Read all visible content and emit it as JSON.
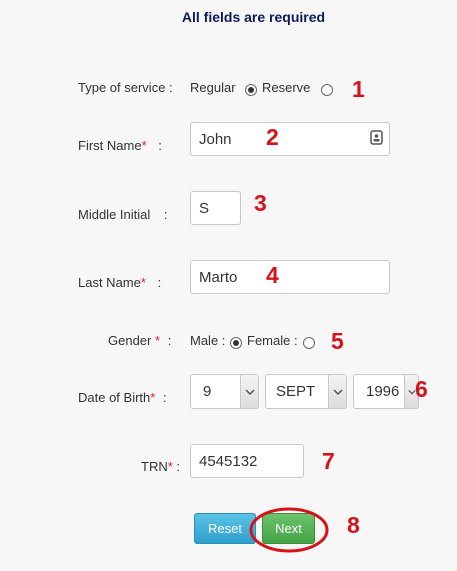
{
  "header": {
    "title": "All fields are required"
  },
  "service": {
    "label": "Type of service :",
    "option1": "Regular",
    "option2": "Reserve",
    "selected": "Regular"
  },
  "first_name": {
    "label": "First Name",
    "required": "*",
    "colon": ":",
    "value": "John"
  },
  "middle_initial": {
    "label": "Middle Initial",
    "colon": ":",
    "value": "S"
  },
  "last_name": {
    "label": "Last Name",
    "required": "*",
    "colon": ":",
    "value": "Marto"
  },
  "gender": {
    "label": "Gender",
    "required": "*",
    "colon": ":",
    "option1": "Male :",
    "option2": "Female :",
    "selected": "Male"
  },
  "dob": {
    "label": "Date of Birth",
    "required": "*",
    "colon": ":",
    "day": "9",
    "month": "SEPT",
    "year": "1996"
  },
  "trn": {
    "label": "TRN",
    "required": "*",
    "colon": ":",
    "value": "4545132"
  },
  "buttons": {
    "reset": "Reset",
    "next": "Next"
  },
  "annotations": [
    "1",
    "2",
    "3",
    "4",
    "5",
    "6",
    "7",
    "8"
  ],
  "colors": {
    "annotation": "#d6121a",
    "required_star": "#d9201f",
    "title": "#0b1a5c",
    "reset_button": "#3aaad8",
    "next_button": "#55b055",
    "highlight_ellipse": "#d6121a"
  },
  "icons": [
    "contact-card-icon",
    "chevron-down-icon"
  ]
}
